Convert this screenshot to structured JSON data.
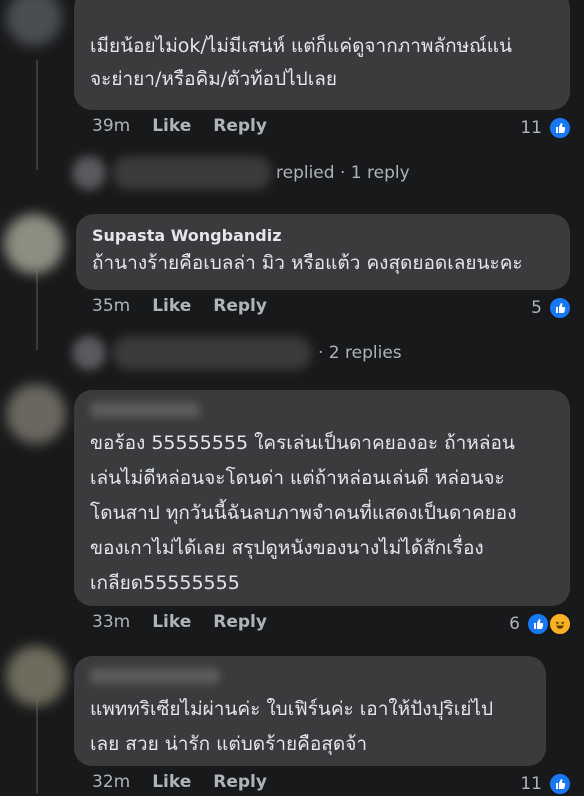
{
  "comments": [
    {
      "text": "เมียน้อยไม่ok/ไม่มีเสน่ห์ แต่ก็แค่ดูจากภาพลักษณ์แน่\nจะย่ายา/หรือคิม/ตัวท้อปไปเลย",
      "time": "39m",
      "like": "Like",
      "reply": "Reply",
      "reactions": "11"
    },
    {
      "author": "Supasta Wongbandiz",
      "text": "ถ้านางร้ายคือเบลล่า มิว หรือแต้ว คงสุดยอดเลยนะคะ",
      "time": "35m",
      "like": "Like",
      "reply": "Reply",
      "reactions": "5"
    },
    {
      "text": "ขอร้อง 55555555 ใครเล่นเป็นดาคยองอะ ถ้าหล่อน\nเล่นไม่ดีหล่อนจะโดนด่า แต่ถ้าหล่อนเล่นดี หล่อนจะ\nโดนสาป ทุกวันนี้ฉันลบภาพจำคนที่แสดงเป็นดาคยอง\nของเกาไม่ได้เลย สรุปดูหนังของนางไม่ได้สักเรื่อง\nเกลียด55555555",
      "time": "33m",
      "like": "Like",
      "reply": "Reply",
      "reactions": "6"
    },
    {
      "text": "แพททริเซียไม่ผ่านค่ะ ใบเฟิร์นค่ะ เอาให้ปังปุริเย่ไป\nเลย สวย น่ารัก แต่บดร้ายคือสุดจ้า",
      "time": "32m",
      "like": "Like",
      "reply": "Reply",
      "reactions": "11"
    }
  ],
  "replies": [
    {
      "text": "replied · 1 reply"
    },
    {
      "text": "· 2 replies"
    }
  ],
  "colors": {
    "bg": "#18191a",
    "bubble": "#3a3b3c",
    "like": "#1877f2",
    "haha": "#f7b125"
  }
}
